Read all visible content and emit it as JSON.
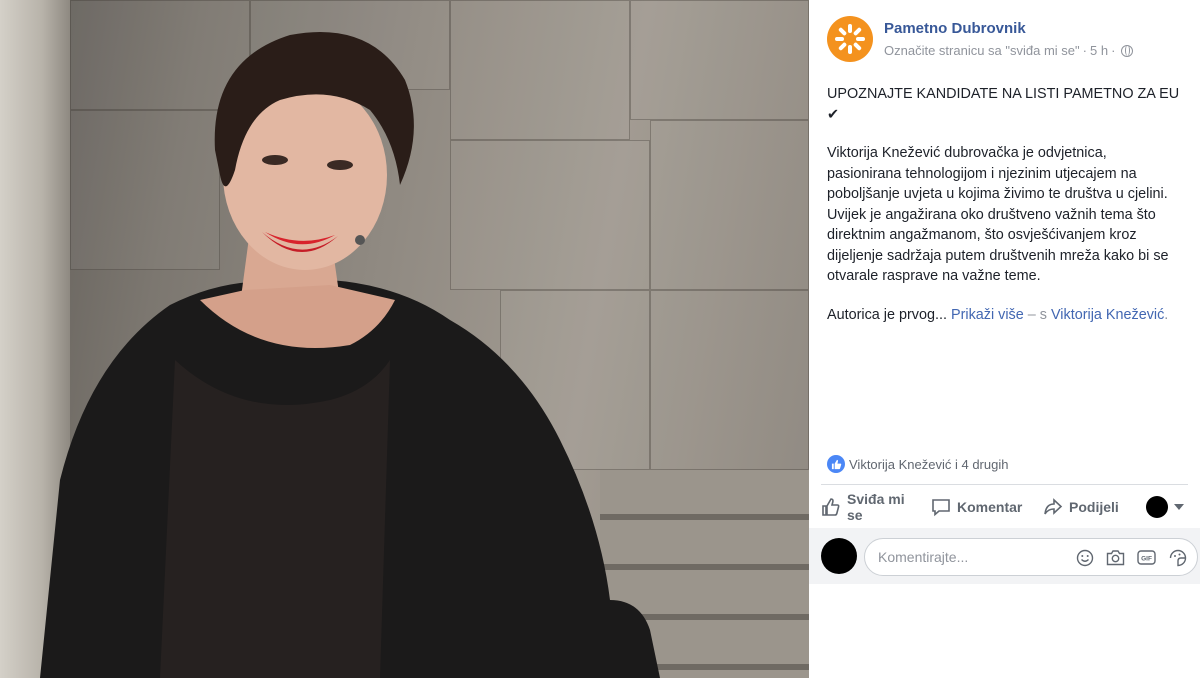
{
  "post": {
    "page_name": "Pametno Dubrovnik",
    "like_page_prompt": "Označite stranicu sa \"sviđa mi se\"",
    "time_sep": "·",
    "time": "5 h",
    "time_sep2": "·",
    "title_line": "UPOZNAJTE KANDIDATE NA LISTI PAMETNO ZA EU",
    "check_mark": "✔",
    "body": "Viktorija Knežević dubrovačka je odvjetnica, pasionirana tehnologijom i njezinim utjecajem na poboljšanje uvjeta u kojima živimo te društva u cjelini. Uvijek je angažirana oko društveno važnih tema što direktnim angažmanom, što osvješćivanjem kroz dijeljenje sadržaja putem društvenih mreža kako bi se otvarale rasprave na važne teme.",
    "truncated": "Autorica je prvog...",
    "see_more": "Prikaži više",
    "with_sep": "– s",
    "tagged_person": "Viktorija Knežević",
    "period": "."
  },
  "reactions": {
    "text": "Viktorija Knežević i 4 drugih"
  },
  "actions": {
    "like": "Sviđa mi se",
    "comment": "Komentar",
    "share": "Podijeli"
  },
  "comment_input": {
    "placeholder": "Komentirajte..."
  },
  "icons": {
    "page_logo": "sun-icon",
    "privacy": "globe-icon",
    "reaction": "thumbs-up-icon",
    "like": "thumbs-up-icon",
    "comment": "speech-bubble-icon",
    "share": "share-arrow-icon",
    "emoji": "emoji-icon",
    "camera": "camera-icon",
    "gif": "gif-icon",
    "sticker": "sticker-icon"
  },
  "colors": {
    "link": "#385898",
    "brand_orange": "#f4921e",
    "like_blue": "#4b87f6"
  }
}
